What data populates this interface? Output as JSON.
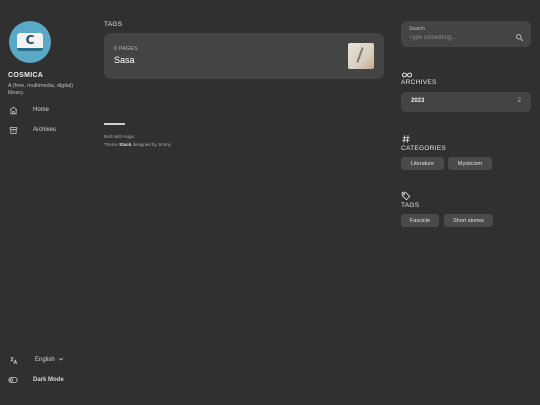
{
  "site": {
    "name": "COSMICA",
    "description": "A (free, multimedia, digital) library.",
    "avatar_letter": "C"
  },
  "menu": {
    "items": [
      {
        "label": "Home",
        "icon": "home-icon"
      },
      {
        "label": "Archives",
        "icon": "archive-box-icon"
      }
    ]
  },
  "bottom_menu": {
    "language": "English",
    "dark_mode_label": "Dark Mode"
  },
  "main": {
    "section_title": "TAGS",
    "tag_card": {
      "count_label": "0 PAGES",
      "name": "Sasa"
    },
    "footer": {
      "built_prefix": "Built with Hugo",
      "theme_prefix": "Theme ",
      "theme_name": "Stack",
      "theme_suffix": " designed by Jimmy"
    }
  },
  "sidebar_right": {
    "search": {
      "label": "Search",
      "placeholder": "Type something..."
    },
    "archives": {
      "title": "ARCHIVES",
      "rows": [
        {
          "year": "2023",
          "count": "2"
        }
      ]
    },
    "categories": {
      "title": "CATEGORIES",
      "items": [
        "Literature",
        "Mysticism"
      ]
    },
    "tags": {
      "title": "TAGS",
      "items": [
        "Fascicle",
        "Short stories"
      ]
    }
  },
  "colors": {
    "background": "#303030",
    "card": "#444444",
    "chip": "#4a4a4a",
    "avatar_accent": "#5aa9c6"
  }
}
